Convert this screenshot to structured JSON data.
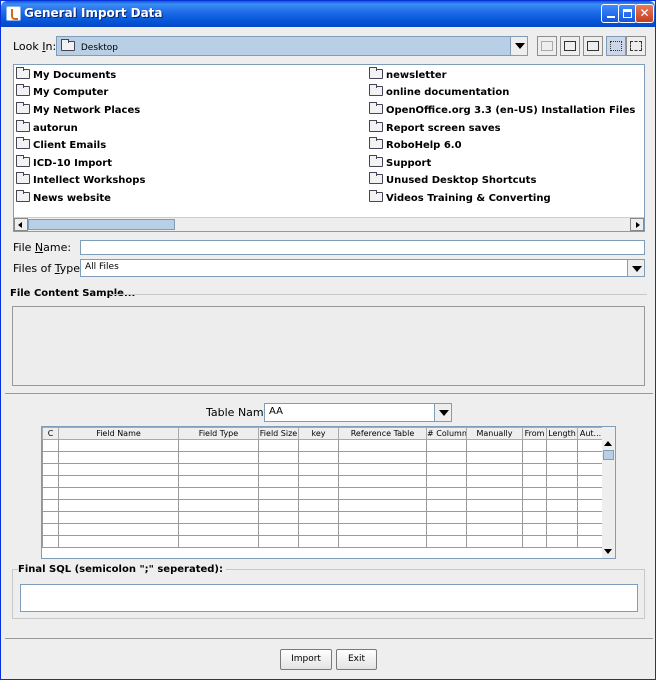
{
  "window": {
    "title": "General Import Data"
  },
  "look_in": {
    "label_pre": "Look ",
    "label_mnemonic": "I",
    "label_post": "n:",
    "value": "Desktop"
  },
  "toolbar_icons": [
    "up-folder-icon",
    "home-icon",
    "new-folder-icon",
    "list-view-icon",
    "details-view-icon"
  ],
  "files": {
    "left": [
      "My Documents",
      "My Computer",
      "My Network Places",
      "autorun",
      "Client Emails",
      "ICD-10 Import",
      "Intellect Workshops",
      "News website"
    ],
    "right": [
      "newsletter",
      "online documentation",
      "OpenOffice.org 3.3 (en-US) Installation Files",
      "Report screen saves",
      "RoboHelp 6.0",
      "Support",
      "Unused Desktop Shortcuts",
      "Videos Training & Converting"
    ]
  },
  "file_name": {
    "label_pre": "File ",
    "label_mnemonic": "N",
    "label_post": "ame:",
    "value": ""
  },
  "files_of_type": {
    "label_pre": "Files of ",
    "label_mnemonic": "T",
    "label_post": "ype:",
    "value": "All Files"
  },
  "content_sample": {
    "title": "File Content Sample..."
  },
  "table_name": {
    "label": "Table Name",
    "value": "AA"
  },
  "grid": {
    "columns": [
      "C",
      "Field Name",
      "Field Type",
      "Field Size",
      "key",
      "Reference Table",
      "# Column",
      "Manually",
      "From",
      "Length",
      "Aut..."
    ]
  },
  "final_sql": {
    "title": "Final SQL (semicolon \";\" seperated):",
    "value": ""
  },
  "buttons": {
    "import": "Import",
    "exit": "Exit"
  }
}
